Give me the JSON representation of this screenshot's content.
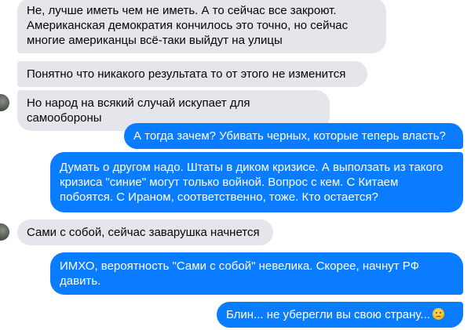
{
  "messages": [
    {
      "side": "in",
      "text": "Не, лучше иметь чем не иметь.  А то сейчас все закроют. Американская демократия кончилось это точно, но сейчас многие американцы всё-таки выйдут на улицы"
    },
    {
      "side": "in",
      "text": "Понятно что никакого результата то от этого не изменится"
    },
    {
      "side": "in",
      "text": "Но народ на всякий случай искупает для самообороны"
    },
    {
      "side": "out",
      "text": "А тогда зачем? Убивать черных, которые теперь власть?"
    },
    {
      "side": "out",
      "text": "Думать о другом надо. Штаты в диком кризисе. А выползать из такого кризиса \"синие\" могут только войной. Вопрос с кем. С Китаем побоятся. С Ираном, соответственно, тоже. Кто остается?"
    },
    {
      "side": "in",
      "text": "Сами с собой, сейчас заварушка начнется"
    },
    {
      "side": "out",
      "text": "ИМХО, вероятность \"Сами с собой\" невелика. Скорее, начнут РФ давить."
    },
    {
      "side": "out",
      "text": "Блин... не уберегли вы свою страну...",
      "emoji": "disappointed-face"
    }
  ],
  "colors": {
    "incoming": "#e4e6eb",
    "outgoing": "#0a7cff"
  }
}
